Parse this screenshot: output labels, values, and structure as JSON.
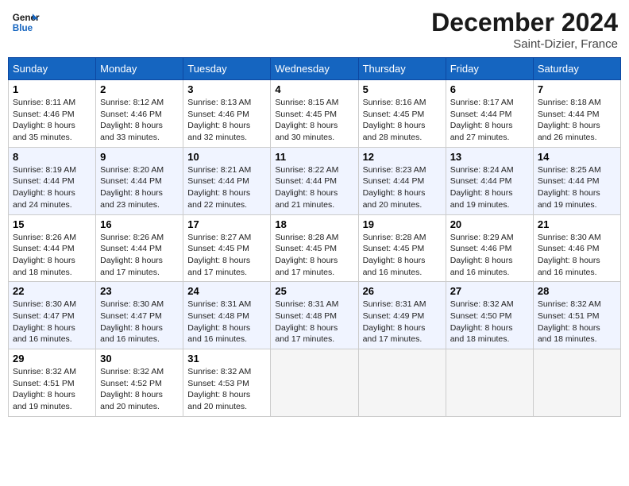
{
  "header": {
    "logo_line1": "General",
    "logo_line2": "Blue",
    "month": "December 2024",
    "location": "Saint-Dizier, France"
  },
  "weekdays": [
    "Sunday",
    "Monday",
    "Tuesday",
    "Wednesday",
    "Thursday",
    "Friday",
    "Saturday"
  ],
  "weeks": [
    [
      {
        "day": "1",
        "sunrise": "8:11 AM",
        "sunset": "4:46 PM",
        "daylight": "8 hours and 35 minutes."
      },
      {
        "day": "2",
        "sunrise": "8:12 AM",
        "sunset": "4:46 PM",
        "daylight": "8 hours and 33 minutes."
      },
      {
        "day": "3",
        "sunrise": "8:13 AM",
        "sunset": "4:46 PM",
        "daylight": "8 hours and 32 minutes."
      },
      {
        "day": "4",
        "sunrise": "8:15 AM",
        "sunset": "4:45 PM",
        "daylight": "8 hours and 30 minutes."
      },
      {
        "day": "5",
        "sunrise": "8:16 AM",
        "sunset": "4:45 PM",
        "daylight": "8 hours and 28 minutes."
      },
      {
        "day": "6",
        "sunrise": "8:17 AM",
        "sunset": "4:44 PM",
        "daylight": "8 hours and 27 minutes."
      },
      {
        "day": "7",
        "sunrise": "8:18 AM",
        "sunset": "4:44 PM",
        "daylight": "8 hours and 26 minutes."
      }
    ],
    [
      {
        "day": "8",
        "sunrise": "8:19 AM",
        "sunset": "4:44 PM",
        "daylight": "8 hours and 24 minutes."
      },
      {
        "day": "9",
        "sunrise": "8:20 AM",
        "sunset": "4:44 PM",
        "daylight": "8 hours and 23 minutes."
      },
      {
        "day": "10",
        "sunrise": "8:21 AM",
        "sunset": "4:44 PM",
        "daylight": "8 hours and 22 minutes."
      },
      {
        "day": "11",
        "sunrise": "8:22 AM",
        "sunset": "4:44 PM",
        "daylight": "8 hours and 21 minutes."
      },
      {
        "day": "12",
        "sunrise": "8:23 AM",
        "sunset": "4:44 PM",
        "daylight": "8 hours and 20 minutes."
      },
      {
        "day": "13",
        "sunrise": "8:24 AM",
        "sunset": "4:44 PM",
        "daylight": "8 hours and 19 minutes."
      },
      {
        "day": "14",
        "sunrise": "8:25 AM",
        "sunset": "4:44 PM",
        "daylight": "8 hours and 19 minutes."
      }
    ],
    [
      {
        "day": "15",
        "sunrise": "8:26 AM",
        "sunset": "4:44 PM",
        "daylight": "8 hours and 18 minutes."
      },
      {
        "day": "16",
        "sunrise": "8:26 AM",
        "sunset": "4:44 PM",
        "daylight": "8 hours and 17 minutes."
      },
      {
        "day": "17",
        "sunrise": "8:27 AM",
        "sunset": "4:45 PM",
        "daylight": "8 hours and 17 minutes."
      },
      {
        "day": "18",
        "sunrise": "8:28 AM",
        "sunset": "4:45 PM",
        "daylight": "8 hours and 17 minutes."
      },
      {
        "day": "19",
        "sunrise": "8:28 AM",
        "sunset": "4:45 PM",
        "daylight": "8 hours and 16 minutes."
      },
      {
        "day": "20",
        "sunrise": "8:29 AM",
        "sunset": "4:46 PM",
        "daylight": "8 hours and 16 minutes."
      },
      {
        "day": "21",
        "sunrise": "8:30 AM",
        "sunset": "4:46 PM",
        "daylight": "8 hours and 16 minutes."
      }
    ],
    [
      {
        "day": "22",
        "sunrise": "8:30 AM",
        "sunset": "4:47 PM",
        "daylight": "8 hours and 16 minutes."
      },
      {
        "day": "23",
        "sunrise": "8:30 AM",
        "sunset": "4:47 PM",
        "daylight": "8 hours and 16 minutes."
      },
      {
        "day": "24",
        "sunrise": "8:31 AM",
        "sunset": "4:48 PM",
        "daylight": "8 hours and 16 minutes."
      },
      {
        "day": "25",
        "sunrise": "8:31 AM",
        "sunset": "4:48 PM",
        "daylight": "8 hours and 17 minutes."
      },
      {
        "day": "26",
        "sunrise": "8:31 AM",
        "sunset": "4:49 PM",
        "daylight": "8 hours and 17 minutes."
      },
      {
        "day": "27",
        "sunrise": "8:32 AM",
        "sunset": "4:50 PM",
        "daylight": "8 hours and 18 minutes."
      },
      {
        "day": "28",
        "sunrise": "8:32 AM",
        "sunset": "4:51 PM",
        "daylight": "8 hours and 18 minutes."
      }
    ],
    [
      {
        "day": "29",
        "sunrise": "8:32 AM",
        "sunset": "4:51 PM",
        "daylight": "8 hours and 19 minutes."
      },
      {
        "day": "30",
        "sunrise": "8:32 AM",
        "sunset": "4:52 PM",
        "daylight": "8 hours and 20 minutes."
      },
      {
        "day": "31",
        "sunrise": "8:32 AM",
        "sunset": "4:53 PM",
        "daylight": "8 hours and 20 minutes."
      },
      null,
      null,
      null,
      null
    ]
  ]
}
